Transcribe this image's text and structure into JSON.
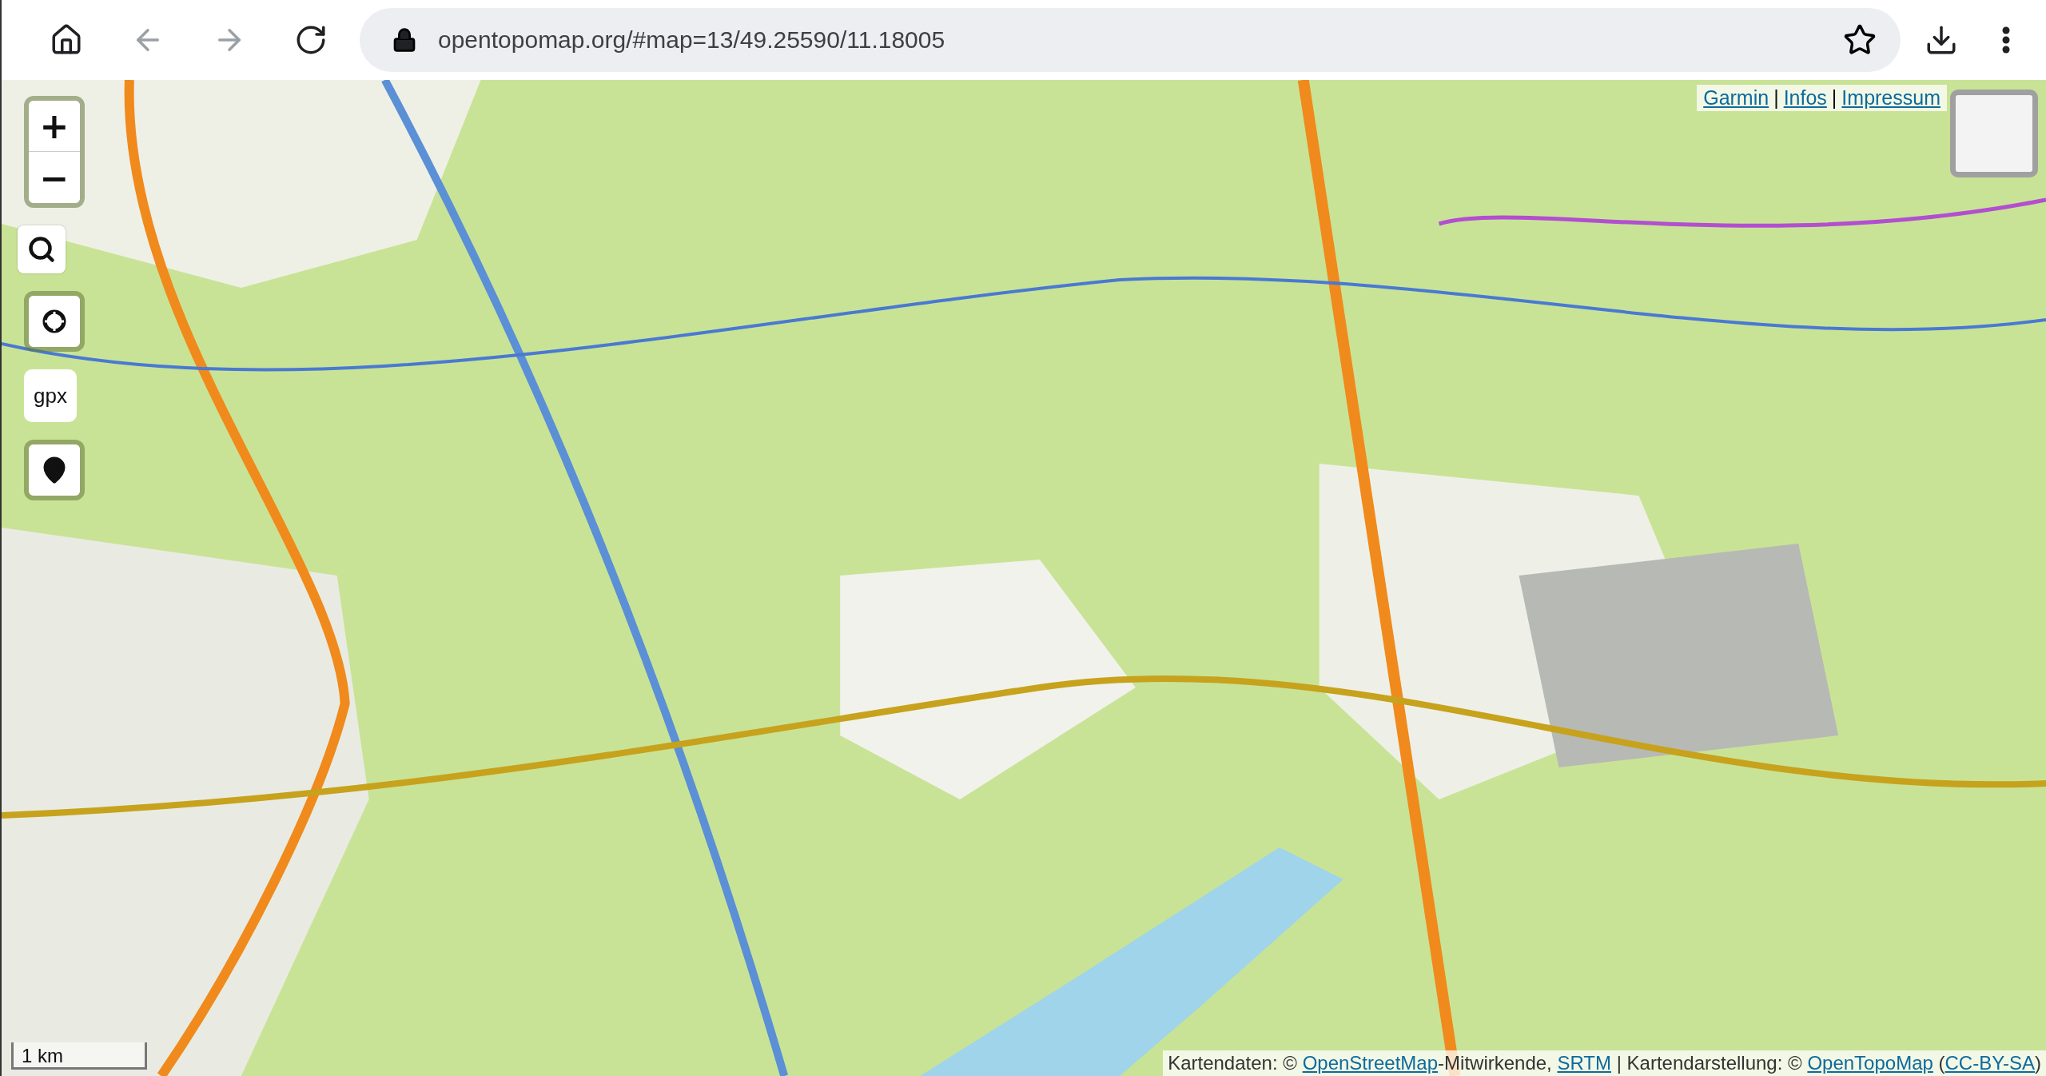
{
  "browser": {
    "url": "opentopomap.org/#map=13/49.25590/11.18005",
    "back_disabled": true,
    "forward_disabled": true
  },
  "map": {
    "zoom_in": "+",
    "zoom_out": "−",
    "gpx": "gpx",
    "top_links": [
      {
        "label": "Garmin"
      },
      {
        "label": "Infos"
      },
      {
        "label": "Impressum"
      }
    ],
    "separators": [
      "|",
      "|"
    ],
    "scale": "1 km",
    "attribution": [
      {
        "kind": "text",
        "text": "Kartendaten: © "
      },
      {
        "kind": "link",
        "text": "OpenStreetMap"
      },
      {
        "kind": "text",
        "text": "-Mitwirkende, "
      },
      {
        "kind": "link",
        "text": "SRTM"
      },
      {
        "kind": "text",
        "text": " | Kartendarstellung: © "
      },
      {
        "kind": "link",
        "text": "OpenTopoMap"
      },
      {
        "kind": "text",
        "text": " ("
      },
      {
        "kind": "link",
        "text": "CC-BY-SA"
      },
      {
        "kind": "text",
        "text": ")"
      }
    ]
  }
}
